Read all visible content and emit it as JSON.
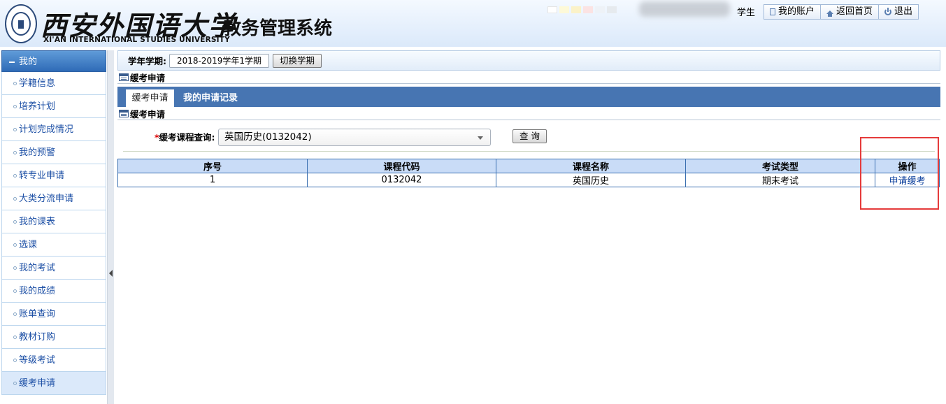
{
  "header": {
    "logo_cn": "西安外国语大学",
    "logo_en": "XI'AN INTERNATIONAL STUDIES UNIVERSITY",
    "system_title": "教务管理系统",
    "role": "学生",
    "links": [
      {
        "label": "我的账户",
        "icon": "account-icon"
      },
      {
        "label": "返回首页",
        "icon": "home-icon"
      },
      {
        "label": "退出",
        "icon": "power-icon"
      }
    ],
    "theme_swatches": [
      "#ffffff",
      "#fdf9d8",
      "#fbf2c8",
      "#fbe3e3",
      "#eef2f7",
      "#e6eaee"
    ]
  },
  "sidebar": {
    "header": "我的",
    "items": [
      {
        "label": "学籍信息"
      },
      {
        "label": "培养计划"
      },
      {
        "label": "计划完成情况"
      },
      {
        "label": "我的预警"
      },
      {
        "label": "转专业申请"
      },
      {
        "label": "大类分流申请"
      },
      {
        "label": "我的课表"
      },
      {
        "label": "选课"
      },
      {
        "label": "我的考试"
      },
      {
        "label": "我的成绩"
      },
      {
        "label": "账单查询"
      },
      {
        "label": "教材订购"
      },
      {
        "label": "等级考试"
      },
      {
        "label": "缓考申请"
      }
    ],
    "active_index": 13
  },
  "term": {
    "label": "学年学期:",
    "value": "2018-2019学年1学期",
    "switch_button": "切换学期"
  },
  "page_title": "缓考申请",
  "tabs": [
    {
      "label": "缓考申请",
      "active": true
    },
    {
      "label": "我的申请记录",
      "active": false
    }
  ],
  "section_title": "缓考申请",
  "query": {
    "required_mark": "*",
    "label": "缓考课程查询:",
    "selected": "英国历史(0132042)",
    "button": "查 询"
  },
  "table": {
    "columns": [
      "序号",
      "课程代码",
      "课程名称",
      "考试类型",
      "操作"
    ],
    "rows": [
      {
        "index": "1",
        "code": "0132042",
        "name": "英国历史",
        "exam_type": "期末考试",
        "action": "申请缓考"
      }
    ]
  },
  "colors": {
    "accent": "#4775b2",
    "annotation": "#e53b3b"
  }
}
